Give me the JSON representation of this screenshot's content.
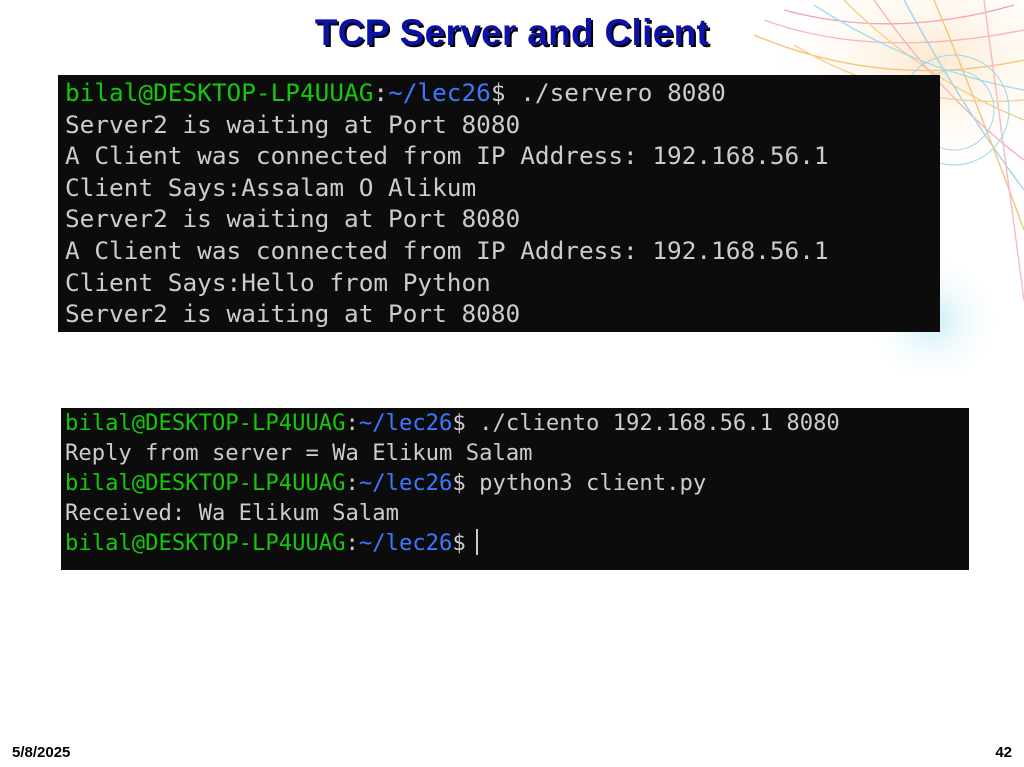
{
  "slide": {
    "title": "TCP Server and Client",
    "date": "5/8/2025",
    "page_number": "42"
  },
  "prompt": {
    "user_host": "bilal@DESKTOP-LP4UUAG",
    "separator": ":",
    "path": "~/lec26",
    "symbol": "$"
  },
  "server_terminal": {
    "command": " ./servero 8080",
    "output": [
      "Server2 is waiting at Port 8080",
      "A Client was connected from IP Address: 192.168.56.1",
      "Client Says:Assalam O Alikum",
      "Server2 is waiting at Port 8080",
      "A Client was connected from IP Address: 192.168.56.1",
      "Client Says:Hello from Python",
      "Server2 is waiting at Port 8080"
    ]
  },
  "client_terminal": {
    "command_1": " ./cliento 192.168.56.1 8080",
    "output_1": "Reply from server = Wa Elikum Salam",
    "command_2": " python3 client.py",
    "output_2": "Received: Wa Elikum Salam"
  },
  "colors": {
    "title": "#0d12a6",
    "terminal_bg": "#0c0c0c",
    "prompt_user": "#16c60c",
    "prompt_path": "#3b78ff",
    "terminal_text": "#cccccc"
  }
}
